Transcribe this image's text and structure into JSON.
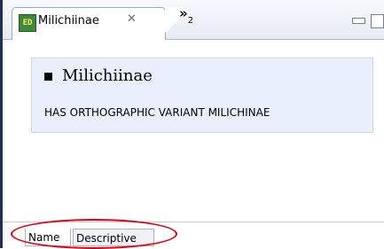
{
  "editor_tab": {
    "icon": "ed-icon",
    "icon_label": "ED",
    "title": "Milichiinae",
    "close_glyph": "✕"
  },
  "overflow": {
    "label": "»",
    "count": "2"
  },
  "window_controls": {
    "minimize": "minimize-icon",
    "maximize": "maximize-icon"
  },
  "content": {
    "heading": "Milichiinae",
    "relation": "HAS ORTHOGRAPHIC VARIANT MILICHINAE"
  },
  "bottom_tabs": [
    {
      "label": "Name"
    },
    {
      "label": "Descriptive"
    }
  ],
  "colors": {
    "highlight": "#e0000f",
    "card_bg": "#eaf0fb",
    "icon_bg": "#3f8a3a"
  }
}
